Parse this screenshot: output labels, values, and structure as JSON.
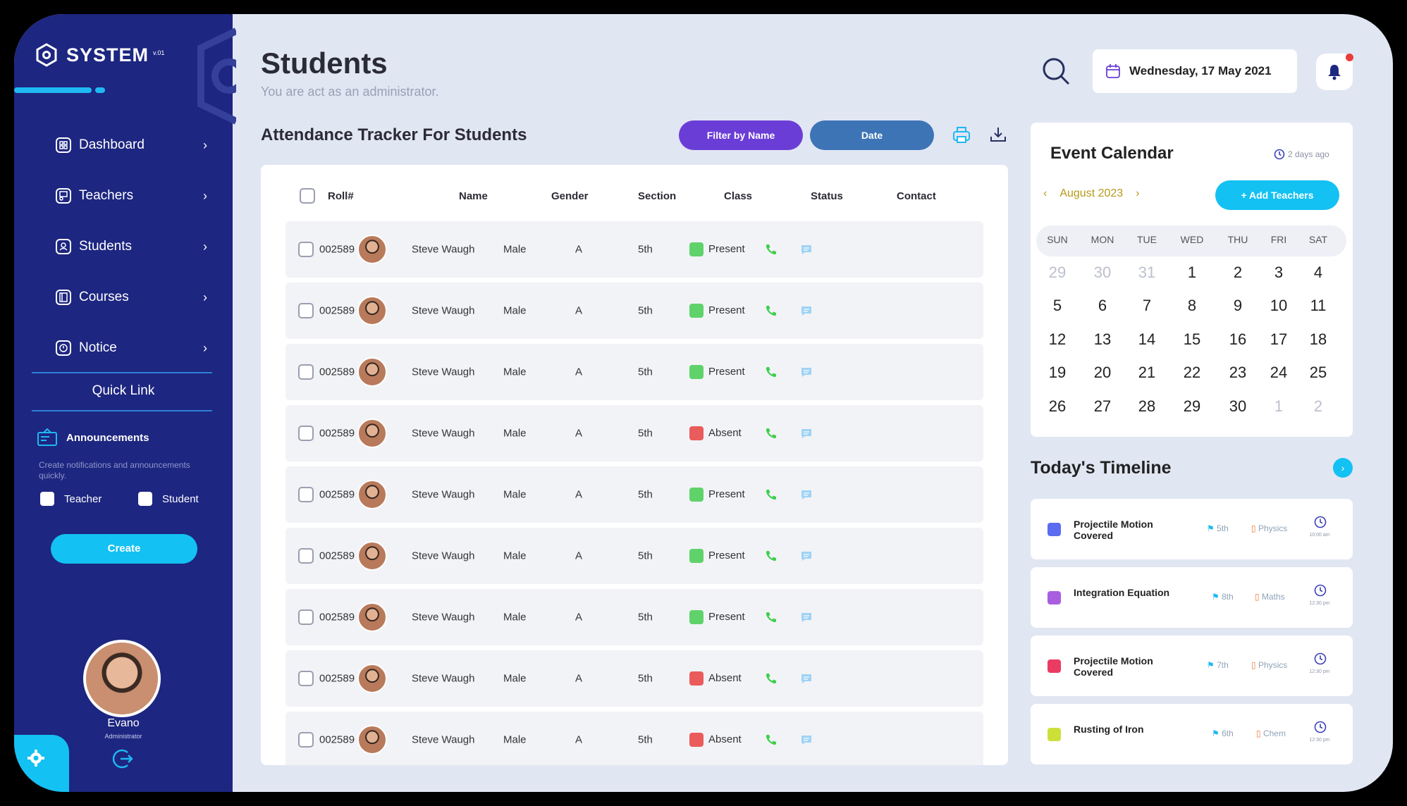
{
  "brand": {
    "name": "SYSTEM",
    "version": "v.01"
  },
  "sidebar": {
    "items": [
      {
        "label": "Dashboard",
        "icon": "dashboard-icon"
      },
      {
        "label": "Teachers",
        "icon": "teachers-icon"
      },
      {
        "label": "Students",
        "icon": "students-icon"
      },
      {
        "label": "Courses",
        "icon": "courses-icon"
      },
      {
        "label": "Notice",
        "icon": "notice-icon"
      }
    ],
    "quick_link": "Quick Link",
    "announcements": {
      "title": "Announcements",
      "description": "Create notifications and announcements quickly.",
      "option_teacher": "Teacher",
      "option_student": "Student",
      "create_label": "Create"
    },
    "user": {
      "name": "Evano",
      "role": "Administrator"
    }
  },
  "header": {
    "title": "Students",
    "subtitle": "You are act as an administrator.",
    "date": "Wednesday, 17 May 2021"
  },
  "attendance": {
    "title": "Attendance Tracker For Students",
    "filter_label": "Filter by Name",
    "date_label": "Date",
    "columns": [
      "Roll#",
      "Name",
      "Gender",
      "Section",
      "Class",
      "Status",
      "Contact"
    ],
    "rows": [
      {
        "roll": "002589",
        "name": "Steve Waugh",
        "gender": "Male",
        "section": "A",
        "class": "5th",
        "status": "Present"
      },
      {
        "roll": "002589",
        "name": "Steve Waugh",
        "gender": "Male",
        "section": "A",
        "class": "5th",
        "status": "Present"
      },
      {
        "roll": "002589",
        "name": "Steve Waugh",
        "gender": "Male",
        "section": "A",
        "class": "5th",
        "status": "Present"
      },
      {
        "roll": "002589",
        "name": "Steve Waugh",
        "gender": "Male",
        "section": "A",
        "class": "5th",
        "status": "Absent"
      },
      {
        "roll": "002589",
        "name": "Steve Waugh",
        "gender": "Male",
        "section": "A",
        "class": "5th",
        "status": "Present"
      },
      {
        "roll": "002589",
        "name": "Steve Waugh",
        "gender": "Male",
        "section": "A",
        "class": "5th",
        "status": "Present"
      },
      {
        "roll": "002589",
        "name": "Steve Waugh",
        "gender": "Male",
        "section": "A",
        "class": "5th",
        "status": "Present"
      },
      {
        "roll": "002589",
        "name": "Steve Waugh",
        "gender": "Male",
        "section": "A",
        "class": "5th",
        "status": "Absent"
      },
      {
        "roll": "002589",
        "name": "Steve Waugh",
        "gender": "Male",
        "section": "A",
        "class": "5th",
        "status": "Absent"
      }
    ],
    "status_colors": {
      "Present": "#5fd36a",
      "Absent": "#ea5b5b"
    }
  },
  "calendar": {
    "title": "Event Calendar",
    "ago": "2 days ago",
    "month": "August 2023",
    "add_label": "+ Add Teachers",
    "weekdays": [
      "SUN",
      "MON",
      "TUE",
      "WED",
      "THU",
      "FRI",
      "SAT"
    ],
    "weeks": [
      [
        [
          "29",
          true
        ],
        [
          "30",
          true
        ],
        [
          "31",
          true
        ],
        [
          "1",
          false
        ],
        [
          "2",
          false
        ],
        [
          "3",
          false
        ],
        [
          "4",
          false
        ]
      ],
      [
        [
          "5",
          false
        ],
        [
          "6",
          false
        ],
        [
          "7",
          false
        ],
        [
          "8",
          false
        ],
        [
          "9",
          false
        ],
        [
          "10",
          false
        ],
        [
          "11",
          false
        ]
      ],
      [
        [
          "12",
          false
        ],
        [
          "13",
          false
        ],
        [
          "14",
          false
        ],
        [
          "15",
          false
        ],
        [
          "16",
          false
        ],
        [
          "17",
          false
        ],
        [
          "18",
          false
        ]
      ],
      [
        [
          "19",
          false
        ],
        [
          "20",
          false
        ],
        [
          "21",
          false
        ],
        [
          "22",
          false
        ],
        [
          "23",
          false
        ],
        [
          "24",
          false
        ],
        [
          "25",
          false
        ]
      ],
      [
        [
          "26",
          false
        ],
        [
          "27",
          false
        ],
        [
          "28",
          false
        ],
        [
          "29",
          false
        ],
        [
          "30",
          false
        ],
        [
          "1",
          true
        ],
        [
          "2",
          true
        ]
      ]
    ]
  },
  "timeline": {
    "title": "Today's Timeline",
    "items": [
      {
        "title": "Projectile Motion Covered",
        "class": "5th",
        "subject": "Physics",
        "time": "10:00 am",
        "color": "#5b6cf0"
      },
      {
        "title": "Integration Equation",
        "class": "8th",
        "subject": "Maths",
        "time": "12:30 pm",
        "color": "#a95ee0"
      },
      {
        "title": "Projectile Motion Covered",
        "class": "7th",
        "subject": "Physics",
        "time": "12:30 pm",
        "color": "#ea3b63"
      },
      {
        "title": "Rusting of Iron",
        "class": "6th",
        "subject": "Chem",
        "time": "12:30 pm",
        "color": "#cde03a"
      }
    ]
  }
}
